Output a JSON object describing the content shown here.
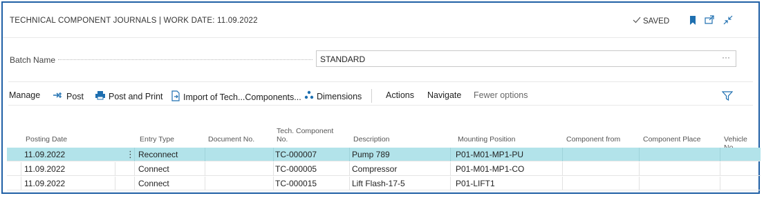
{
  "header": {
    "title": "TECHNICAL COMPONENT JOURNALS | WORK DATE: 11.09.2022",
    "saved_label": "SAVED"
  },
  "batch": {
    "label": "Batch Name",
    "value": "STANDARD",
    "more": "···"
  },
  "actions": {
    "manage": "Manage",
    "post": "Post",
    "post_and_print": "Post and Print",
    "import": "Import of Tech...Components...",
    "dimensions": "Dimensions",
    "actions": "Actions",
    "navigate": "Navigate",
    "fewer_options": "Fewer options"
  },
  "columns": {
    "posting_date": "Posting Date",
    "entry_type": "Entry Type",
    "document_no": "Document No.",
    "tech_component_no_1": "Tech. Component",
    "tech_component_no_2": "No.",
    "description": "Description",
    "mounting_position": "Mounting Position",
    "component_from": "Component from",
    "component_place": "Component Place",
    "vehicle_no": "Vehicle No."
  },
  "rows": [
    {
      "posting_date": "11.09.2022",
      "entry_type": "Reconnect",
      "document_no": "",
      "tech_component_no": "TC-000007",
      "description": "Pump 789",
      "mounting_position": "P01-M01-MP1-PU",
      "component_from": "",
      "component_place": "",
      "vehicle_no": ""
    },
    {
      "posting_date": "11.09.2022",
      "entry_type": "Connect",
      "document_no": "",
      "tech_component_no": "TC-000005",
      "description": "Compressor",
      "mounting_position": "P01-M01-MP1-CO",
      "component_from": "",
      "component_place": "",
      "vehicle_no": ""
    },
    {
      "posting_date": "11.09.2022",
      "entry_type": "Connect",
      "document_no": "",
      "tech_component_no": "TC-000015",
      "description": "Lift Flash-17-5",
      "mounting_position": "P01-LIFT1",
      "component_from": "",
      "component_place": "",
      "vehicle_no": ""
    }
  ],
  "colors": {
    "frame_border": "#1f5fa5",
    "accent": "#1e7fa6",
    "selected_row": "#b2e3ea"
  },
  "icons": [
    "checkmark-icon",
    "bookmark-icon",
    "open-new-window-icon",
    "collapse-icon",
    "post-icon",
    "printer-icon",
    "import-document-icon",
    "dimensions-icon",
    "filter-icon",
    "row-menu-icon"
  ]
}
